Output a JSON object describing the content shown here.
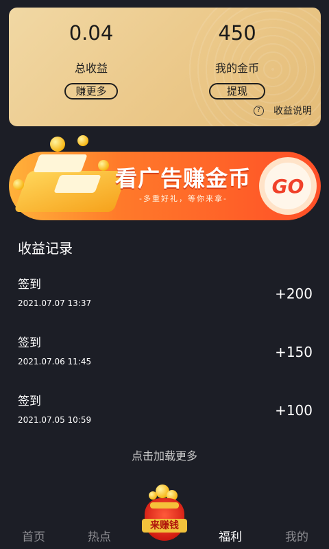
{
  "earnings": {
    "total_value": "0.04",
    "total_label": "总收益",
    "earn_more_button": "赚更多",
    "coins_value": "450",
    "coins_label": "我的金币",
    "withdraw_button": "提现",
    "help_icon": "question-circle-icon",
    "help_glyph": "?",
    "help_label": "收益说明"
  },
  "banner": {
    "title": "看广告赚金币",
    "subtitle": "-多重好礼，等你来拿-",
    "go_label": "GO"
  },
  "records": {
    "title": "收益记录",
    "items": [
      {
        "title": "签到",
        "time": "2021.07.07 13:37",
        "amount": "+200"
      },
      {
        "title": "签到",
        "time": "2021.07.06 11:45",
        "amount": "+150"
      },
      {
        "title": "签到",
        "time": "2021.07.05 10:59",
        "amount": "+100"
      }
    ],
    "load_more": "点击加载更多"
  },
  "nav": {
    "items": [
      {
        "label": "首页",
        "active": false
      },
      {
        "label": "热点",
        "active": false
      },
      {
        "label": "福利",
        "active": true
      },
      {
        "label": "我的",
        "active": false
      }
    ],
    "center_label": "来赚钱"
  },
  "colors": {
    "background": "#1c1e26",
    "card_gold": "#ebc889",
    "banner_orange": "#ff7a2a",
    "go_red": "#f0412a",
    "nav_inactive": "#8d8d92"
  }
}
